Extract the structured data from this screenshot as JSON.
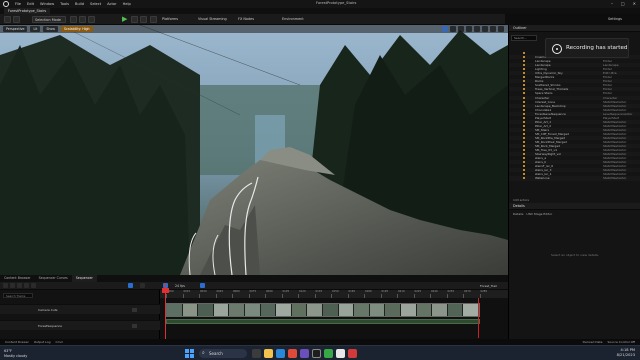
{
  "menubar": {
    "items": [
      "File",
      "Edit",
      "Window",
      "Tools",
      "Build",
      "Select",
      "Actor",
      "Help"
    ],
    "window_title": "ForestPrototype_Stairs",
    "win_controls": [
      "–",
      "□",
      "✕"
    ]
  },
  "document_tab": "ForestPrototype_Stairs",
  "toolbar": {
    "mode_label": "Selection Mode",
    "platforms_label": "Platforms",
    "streaming_label": "Visual Streaming",
    "fx_label": "FX Nodes",
    "env_label": "Environment",
    "settings_label": "Settings"
  },
  "viewport": {
    "chips": [
      "Perspective",
      "Lit",
      "Show",
      "Scalability: High"
    ],
    "accent_orange": "#8a5a14"
  },
  "outliner": {
    "title": "Outliner",
    "search_placeholder": "Search...",
    "rows": [
      {
        "label": "",
        "type": "World"
      },
      {
        "label": "Cinematics",
        "type": "Folder"
      },
      {
        "label": "Landscape",
        "type": "Folder"
      },
      {
        "label": "Landscape",
        "type": "Landscape"
      },
      {
        "label": "Lighting",
        "type": "Folder"
      },
      {
        "label": "Ultra_Dynamic_Sky",
        "type": "Edit Ultra"
      },
      {
        "label": "MergedRocks",
        "type": "Folder"
      },
      {
        "label": "Rocks",
        "type": "Folder"
      },
      {
        "label": "Scattered_Shrubs",
        "type": "Folder"
      },
      {
        "label": "Trees_Vertical_Thickets",
        "type": "Folder"
      },
      {
        "label": "Spare Stairs",
        "type": "Folder"
      },
      {
        "label": "Character",
        "type": "Character"
      },
      {
        "label": "Interest_Cone",
        "type": "StaticMeshActor"
      },
      {
        "label": "Landscape_Backdrop",
        "type": "StaticMeshActor"
      },
      {
        "label": "Chocolate1",
        "type": "StaticMeshActor"
      },
      {
        "label": "ForestLevelSequence",
        "type": "LevelSequenceActor"
      },
      {
        "label": "PlayerStart",
        "type": "PlayerStart"
      },
      {
        "label": "Pillar_Art_1",
        "type": "StaticMeshActor"
      },
      {
        "label": "Pillar_Art_2",
        "type": "StaticMeshActor"
      },
      {
        "label": "SM_Stairs",
        "type": "StaticMeshActor"
      },
      {
        "label": "SM_Cliff_Forest_Merged",
        "type": "StaticMeshActor"
      },
      {
        "label": "SM_RockPile_Merged",
        "type": "StaticMeshActor"
      },
      {
        "label": "SM_RockPile2_Merged",
        "type": "StaticMeshActor"
      },
      {
        "label": "SM_Rock_Merged",
        "type": "StaticMeshActor"
      },
      {
        "label": "SM_Tree_03_v4",
        "type": "StaticMeshActor"
      },
      {
        "label": "StairwayRight_vol",
        "type": "StaticMeshActor"
      },
      {
        "label": "stairs_a",
        "type": "StaticMeshActor"
      },
      {
        "label": "stairs_b",
        "type": "StaticMeshActor"
      },
      {
        "label": "stairsF_ler_6",
        "type": "StaticMeshActor"
      },
      {
        "label": "stairs_ler_3",
        "type": "StaticMeshActor"
      },
      {
        "label": "stairs_ler_1",
        "type": "StaticMeshActor"
      },
      {
        "label": "WaterLine",
        "type": "StaticMeshActor"
      }
    ],
    "count_label": "143 actors"
  },
  "recording_toast": "Recording has started",
  "details": {
    "title": "Details",
    "tabs": [
      "Details",
      "USD Stage Editor"
    ],
    "empty_text": "Select an object to view details."
  },
  "bottom_tabs": [
    "Content Browser",
    "Sequencer Curves",
    "Sequencer"
  ],
  "sequencer": {
    "fps": "24 fps",
    "track_name": "Forest_Trail",
    "search_placeholder": "Search Tracks",
    "tracks": [
      "Camera Cuts",
      "ForestSequence"
    ],
    "ruler_labels": [
      "0000",
      "0015",
      "0030",
      "0045",
      "0060",
      "0075",
      "0090",
      "0105",
      "0120",
      "0135",
      "0150",
      "0165",
      "0180",
      "0195",
      "0210",
      "0225",
      "0240",
      "0255",
      "0270",
      "0285"
    ]
  },
  "statusbar": [
    "Content Drawer",
    "Output Log",
    "Cmd",
    "Derived Data",
    "Source Control Off"
  ],
  "taskbar": {
    "search_label": "Search",
    "weather_temp": "63°F",
    "weather_desc": "Mostly cloudy",
    "time": "4:18 PM",
    "date": "8/21/2023"
  },
  "colors": {
    "play_green": "#4fc34f",
    "sequencer_blue": "#2a6fd0",
    "playhead_red": "#e03030",
    "windows_blue": "#4aa3ff"
  }
}
